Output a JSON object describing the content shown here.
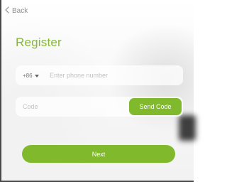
{
  "nav": {
    "back_label": "Back"
  },
  "screen": {
    "title": "Register"
  },
  "phone": {
    "country_code": "+86",
    "placeholder": "Enter phone number",
    "value": ""
  },
  "code": {
    "placeholder": "Code",
    "value": "",
    "send_label": "Send Code"
  },
  "actions": {
    "next_label": "Next"
  },
  "theme": {
    "accent": "#80ba2c",
    "title_color": "#86b83a",
    "muted_text": "#8f8f8f"
  },
  "icons": {
    "back": "chevron-left-icon",
    "dropdown": "caret-down-icon"
  }
}
